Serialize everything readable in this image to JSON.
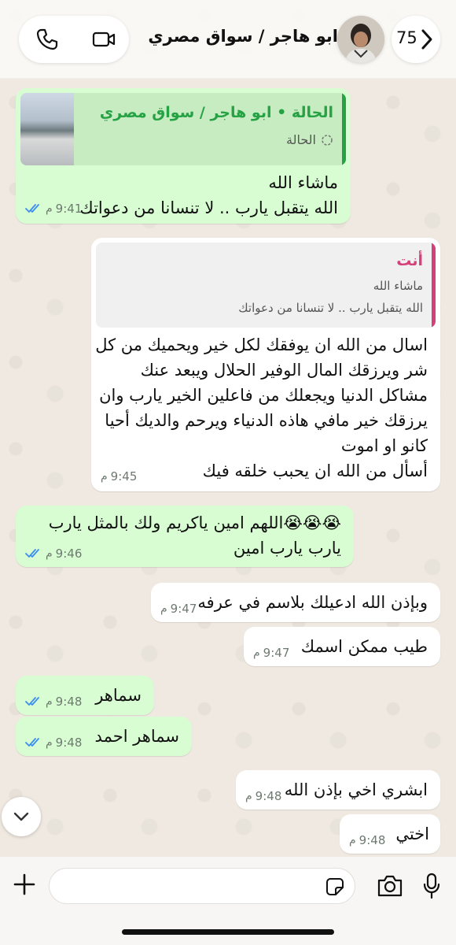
{
  "header": {
    "back_count": "75",
    "contact_name": "ابو هاجر / سواق مصري"
  },
  "messages": {
    "m1": {
      "quote_title": "الحالة • ابو هاجر / سواق مصري",
      "quote_sub": "الحالة",
      "lines": [
        "ماشاء الله",
        "الله يتقبل يارب .. لا تنسانا من دعواتك"
      ],
      "time": "9:41",
      "ampm": "م"
    },
    "m2": {
      "quote_author": "أنت",
      "quote_line1": "ماشاء الله",
      "quote_line2": "الله يتقبل يارب .. لا تنسانا من دعواتك",
      "lines": [
        "اسال من الله ان يوفقك لكل خير ويحميك من كل",
        "شر ويرزقك المال الوفير الحلال ويبعد عنك",
        "مشاكل الدنيا ويجعلك من فاعلين الخير يارب وان",
        "يرزقك خير مافي هاذه الدنياء ويرحم والديك أحيا",
        "كانو او اموت",
        "أسأل من الله ان يحبب خلقه فيك"
      ],
      "time": "9:45",
      "ampm": "م"
    },
    "m3": {
      "lines": [
        "😭😭😭اللهم امين ياكريم ولك بالمثل يارب",
        "يارب يارب امين"
      ],
      "time": "9:46",
      "ampm": "م"
    },
    "m4": {
      "text": "وبإذن الله ادعيلك بلاسم في عرفه",
      "time": "9:47",
      "ampm": "م"
    },
    "m5": {
      "text": "طيب ممكن اسمك",
      "time": "9:47",
      "ampm": "م"
    },
    "m6": {
      "text": "سماهر",
      "time": "9:48",
      "ampm": "م"
    },
    "m7": {
      "text": "سماهر احمد",
      "time": "9:48",
      "ampm": "م"
    },
    "m8": {
      "text": "ابشري اخي بإذن الله",
      "time": "9:48",
      "ampm": "م"
    },
    "m9": {
      "text": "اختي",
      "time": "9:48",
      "ampm": "م"
    }
  },
  "icons": [
    "phone-icon",
    "video-icon",
    "chevron-left-icon",
    "plus-icon",
    "sticker-icon",
    "camera-icon",
    "microphone-icon",
    "chevron-down-icon",
    "double-check-icon"
  ],
  "colors": {
    "outgoing_bubble": "#d8fdd2",
    "incoming_bubble": "#ffffff",
    "status_quote_accent": "#25a244",
    "own_quote_accent": "#d4417a",
    "read_ticks": "#3b8df0"
  }
}
